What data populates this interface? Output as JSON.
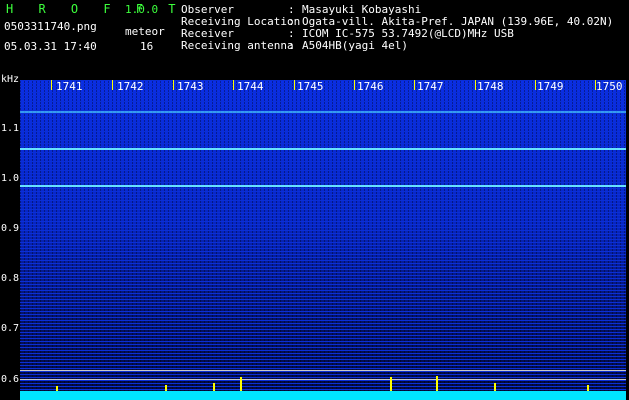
{
  "header": {
    "app_name": "H R O F F T",
    "version": "1.0.0",
    "filename": "0503311740.png",
    "datetime": "05.03.31 17:40",
    "meteor_label": "meteor",
    "meteor_count": "16"
  },
  "info": [
    {
      "key": "Observer",
      "value": "Masayuki Kobayashi"
    },
    {
      "key": "Receiving Location",
      "value": "Ogata-vill. Akita-Pref. JAPAN (139.96E, 40.02N)"
    },
    {
      "key": "Receiver",
      "value": "ICOM IC-575 53.7492(@LCD)MHz USB"
    },
    {
      "key": "Receiving antenna",
      "value": "A504HB(yagi 4el)"
    }
  ],
  "y_axis": {
    "unit": "kHz",
    "labels": [
      "1.1",
      "1.0",
      "0.9",
      "0.8",
      "0.7",
      "0.6"
    ]
  },
  "time_labels": [
    "1741",
    "1742",
    "1743",
    "1744",
    "1745",
    "1746",
    "1747",
    "1748",
    "1749",
    "1750"
  ],
  "colors": {
    "spectrogram_blue": "#0a2ee8",
    "carrier_line": "#66e0ff",
    "meteor_spike": "#ffff00",
    "baseline": "#00e5ff"
  }
}
